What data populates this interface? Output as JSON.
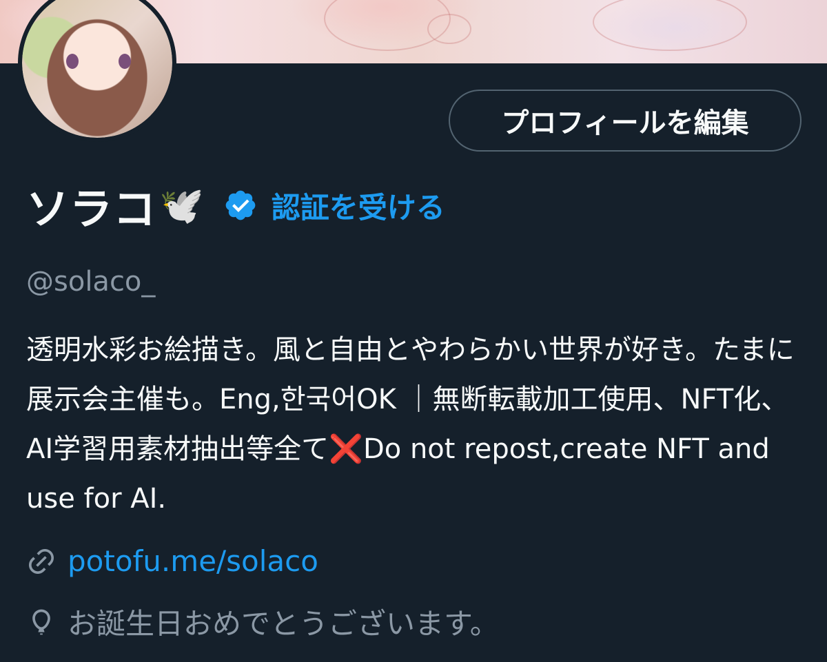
{
  "profile": {
    "edit_button_label": "プロフィールを編集",
    "display_name": "ソラコ",
    "name_emoji": "🕊️",
    "verify_link": "認証を受ける",
    "handle": "@solaco_",
    "bio": "透明水彩お絵描き。風と自由とやわらかい世界が好き。たまに展示会主催も。Eng,한국어OK ｜無断転載加工使用、NFT化、AI学習用素材抽出等全て❌Do not repost,create NFT and use for AI.",
    "link_text": "potofu.me/solaco",
    "birthday_text": "お誕生日おめでとうございます。"
  },
  "icons": {
    "verified": "verified-badge-icon",
    "link": "link-icon",
    "balloon": "balloon-icon"
  },
  "colors": {
    "background": "#15202b",
    "accent": "#1d9bf0",
    "muted_text": "#8b98a5",
    "button_border": "#536471"
  }
}
